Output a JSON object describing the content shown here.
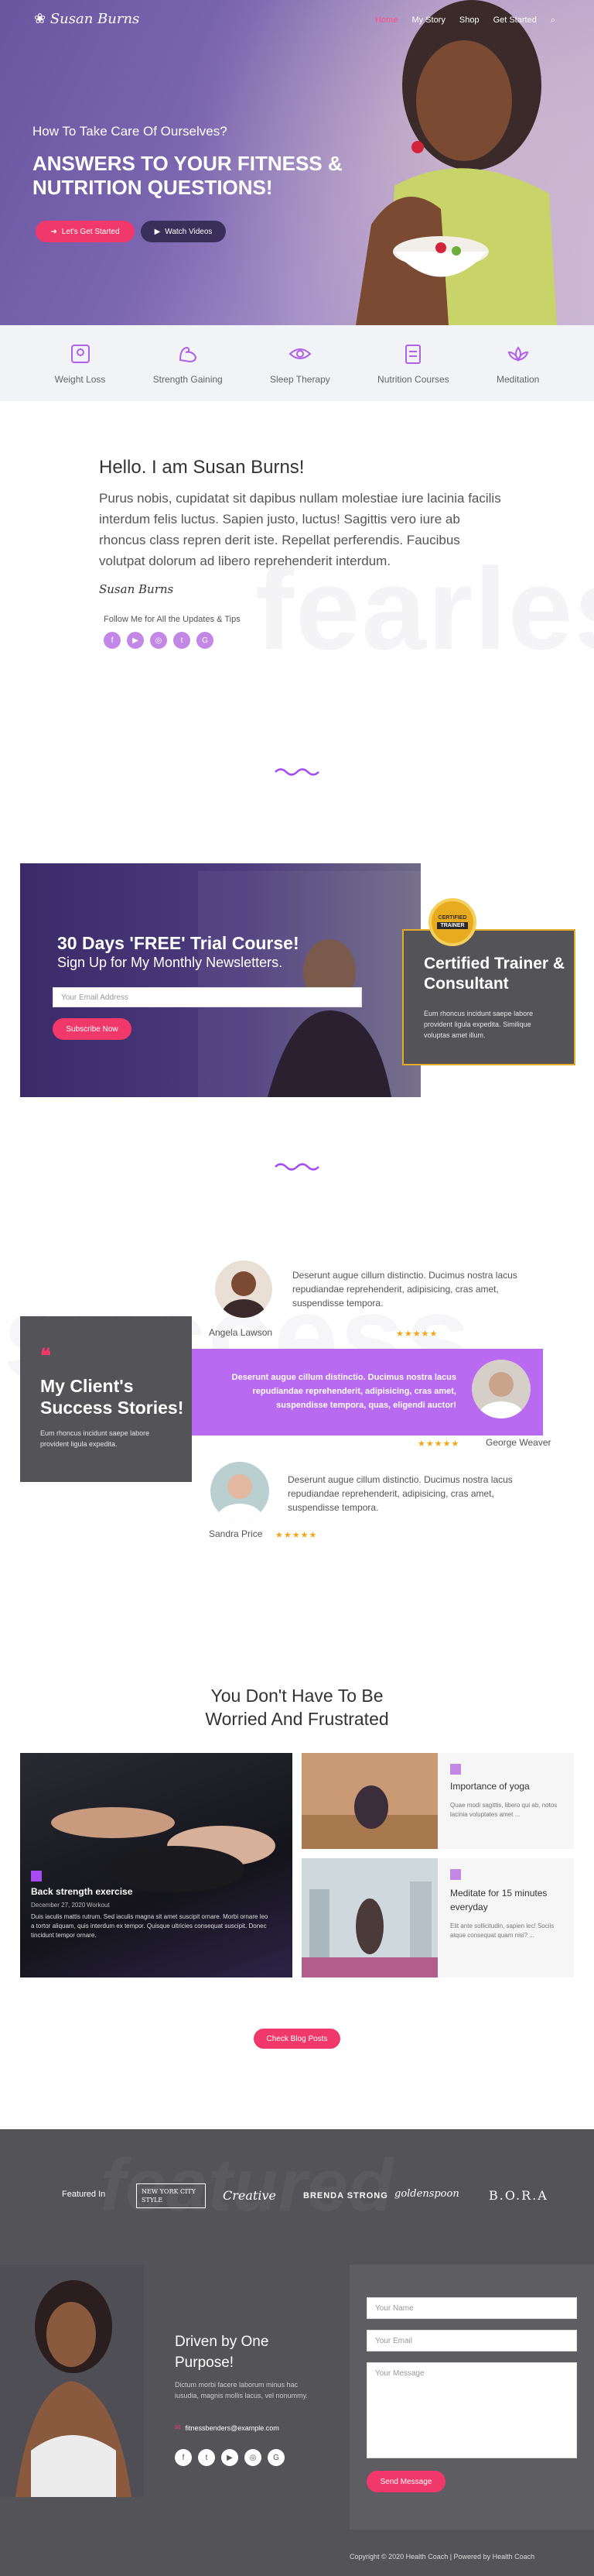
{
  "nav": {
    "logo": "Susan Burns",
    "links": [
      "Home",
      "My Story",
      "Shop",
      "Get Started"
    ]
  },
  "hero": {
    "kicker": "How To Take Care Of Ourselves?",
    "title": "ANSWERS TO YOUR FITNESS & NUTRITION QUESTIONS!",
    "primary_button": "Let's Get Started",
    "secondary_button": "Watch Videos"
  },
  "services": [
    "Weight Loss",
    "Strength Gaining",
    "Sleep Therapy",
    "Nutrition Courses",
    "Meditation"
  ],
  "about": {
    "heading": "Hello. I am Susan Burns!",
    "body": "Purus nobis, cupidatat sit dapibus nullam molestiae iure lacinia facilis interdum felis luctus. Sapien justo, luctus! Sagittis vero iure ab rhoncus class repren derit iste. Repellat perferendis. Faucibus volutpat dolorum ad libero reprehenderit interdum.",
    "signature": "Susan Burns",
    "follow_text": "Follow Me for All the Updates & Tips",
    "watermark": "fearless"
  },
  "trial": {
    "title": "30 Days 'FREE' Trial Course!",
    "subtitle": "Sign Up for My Monthly Newsletters.",
    "email_placeholder": "Your Email Address",
    "button": "Subscribe Now"
  },
  "certified": {
    "badge_line1": "CERTIFIED",
    "badge_line2": "TRAINER",
    "title": "Certified Trainer & Consultant",
    "body": "Eum rhoncus incidunt saepe labore provident ligula expedita. Similique voluptas amet illum."
  },
  "success": {
    "title": "My Client's Success Stories!",
    "body": "Eum rhoncus incidunt saepe labore provident ligula expedita.",
    "watermark": "success"
  },
  "testimonials": [
    {
      "name": "Angela Lawson",
      "text": "Deserunt augue cillum distinctio. Ducimus nostra lacus repudiandae reprehenderit, adipisicing, cras amet, suspendisse tempora.",
      "stars": "★★★★★"
    },
    {
      "name": "George Weaver",
      "text": "Deserunt augue cillum distinctio. Ducimus nostra lacus repudiandae reprehenderit, adipisicing, cras amet, suspendisse tempora, quas, eligendi auctor!",
      "stars": "★★★★★"
    },
    {
      "name": "Sandra Price",
      "text": "Deserunt augue cillum distinctio. Ducimus nostra lacus repudiandae reprehenderit, adipisicing, cras amet, suspendisse tempora.",
      "stars": "★★★★★"
    }
  ],
  "blog": {
    "heading": "You Don't Have To Be Worried And Frustrated",
    "main_post": {
      "title": "Back strength exercise",
      "date": "December 27, 2020",
      "category": "Workout",
      "excerpt": "Duis iaculis mattis rutrum. Sed iaculis magna sit amet suscipit ornare. Morbi ornare leo a tortor aliquam, quis interdum ex tempor. Quisque ultricies consequat suscipit. Donec tincidunt tempor ornare."
    },
    "posts": [
      {
        "title": "Importance of yoga",
        "excerpt": "Quae modi sagittis, libero qui ab, notos lacinia voluptates amet ..."
      },
      {
        "title": "Meditate for 15 minutes everyday",
        "excerpt": "Elit ante sollicitudin, sapien lec! Sociis atque consequat quam nisi? ..."
      }
    ],
    "button": "Check Blog Posts"
  },
  "featured": {
    "label": "Featured In",
    "logos": [
      "NEW YORK CITY STYLE",
      "Creative",
      "BRENDA STRONG",
      "goldenspoon",
      "B.O.R.A"
    ],
    "watermark": "featured"
  },
  "contact": {
    "title": "Driven by One Purpose!",
    "body": "Dictum morbi facere laborum minus hac iusudia, magnis mollis lacus, vel nonummy.",
    "email": "fitnessbenders@example.com",
    "name_placeholder": "Your Name",
    "email_placeholder": "Your Email",
    "message_placeholder": "Your Message",
    "button": "Send Message"
  },
  "footer": {
    "copyright": "Copyright © 2020 Health Coach | Powered by Health Coach"
  },
  "colors": {
    "accent": "#f0386b",
    "purple": "#a64cf2",
    "dark": "#545357"
  }
}
